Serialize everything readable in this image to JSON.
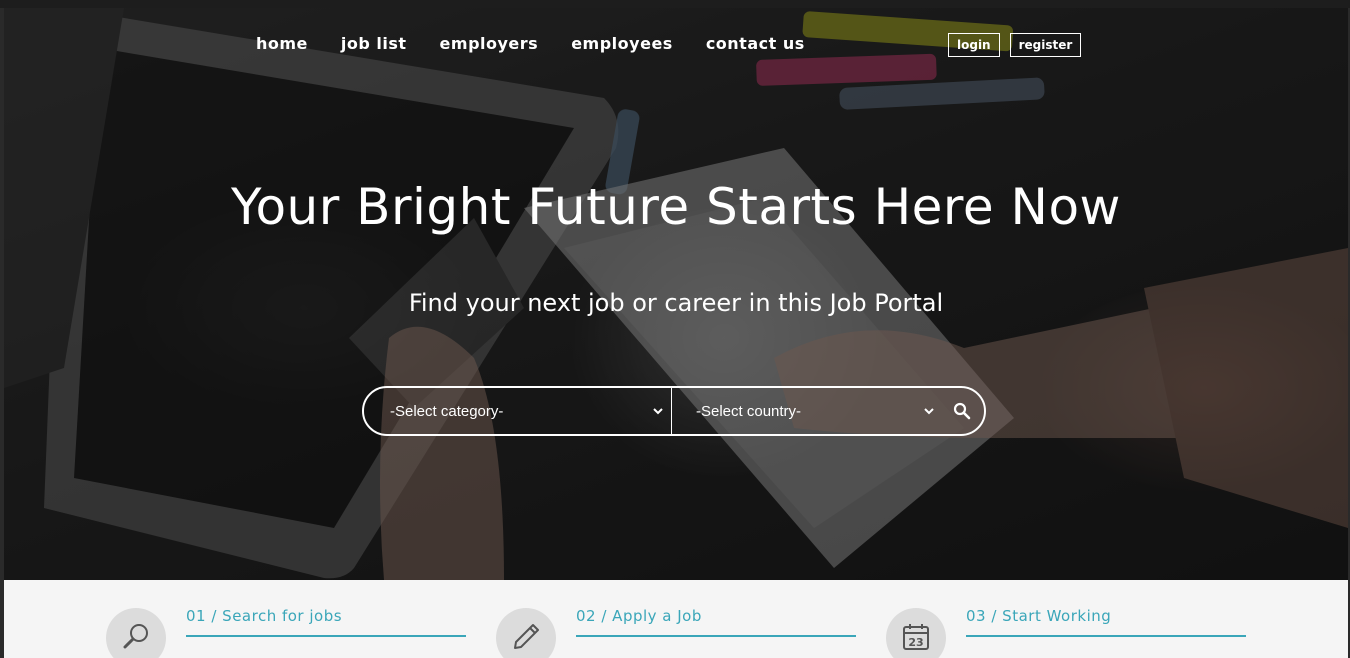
{
  "nav": {
    "items": [
      {
        "label": "home"
      },
      {
        "label": "job list"
      },
      {
        "label": "employers"
      },
      {
        "label": "employees"
      },
      {
        "label": "contact us"
      }
    ],
    "login_label": "login",
    "register_label": "register"
  },
  "hero": {
    "title": "Your Bright Future Starts Here Now",
    "subtitle": "Find your next job or career in this Job Portal"
  },
  "search": {
    "category_value": "-Select category-",
    "country_value": "-Select country-",
    "icon": "search-icon"
  },
  "steps": [
    {
      "label": "01 / Search for jobs",
      "icon": "magnifier-icon"
    },
    {
      "label": "02 / Apply a Job",
      "icon": "pencil-icon"
    },
    {
      "label": "03 / Start Working",
      "icon": "calendar-icon",
      "calendar_day": "23"
    }
  ],
  "colors": {
    "accent": "#3aa6b9",
    "text_on_hero": "#ffffff",
    "steps_background": "#f5f5f5",
    "step_icon_circle": "#dcdcdc"
  }
}
